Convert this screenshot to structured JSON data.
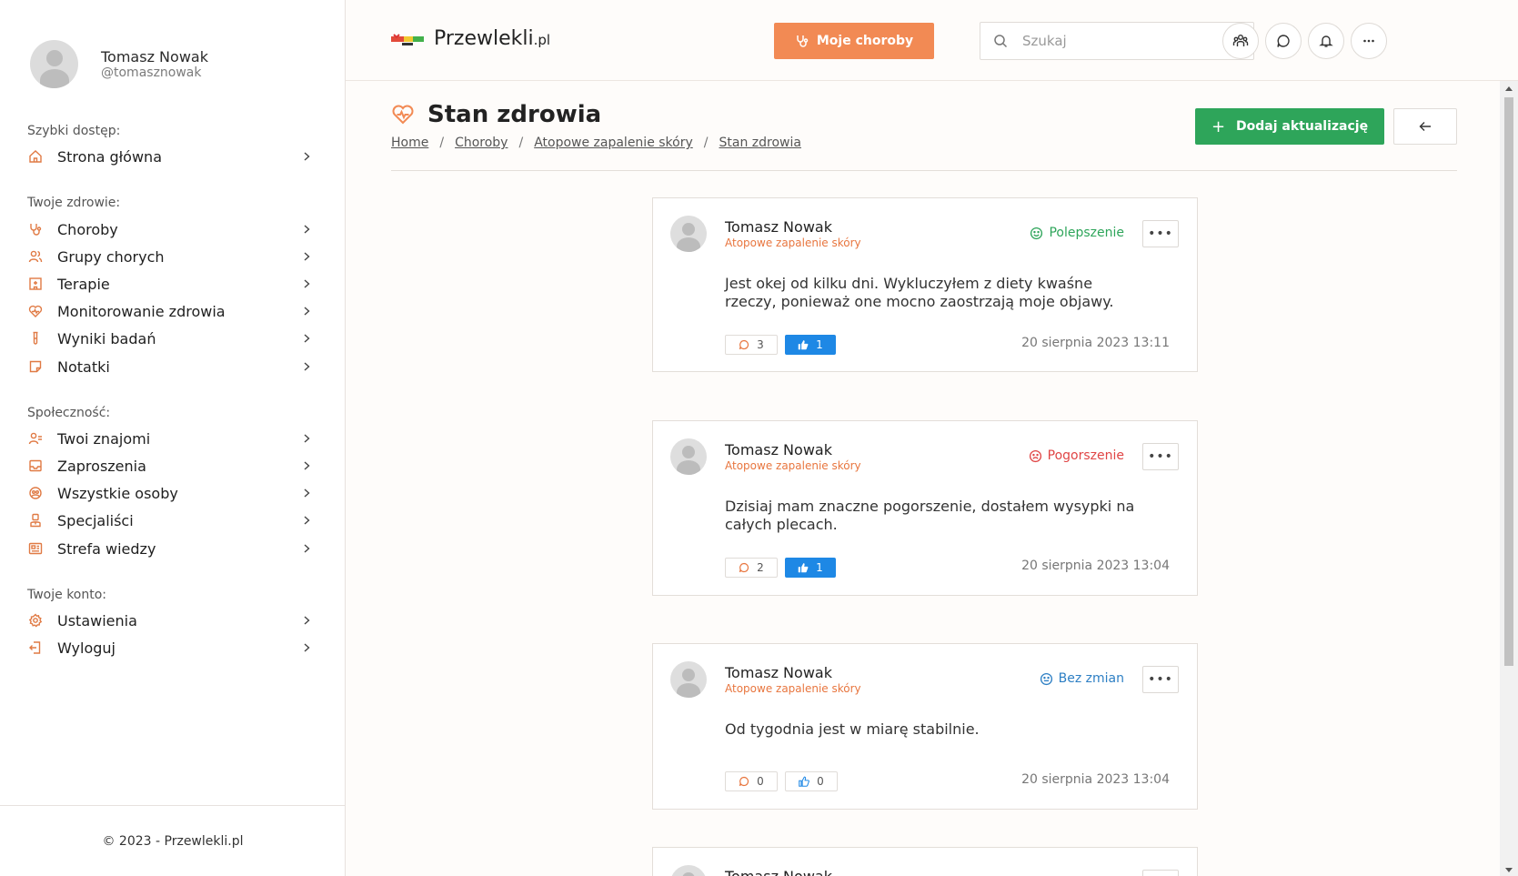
{
  "sidebar": {
    "user": {
      "name": "Tomasz Nowak",
      "handle": "@tomasznowak"
    },
    "sections": [
      {
        "title": "Szybki dostęp:",
        "items": [
          {
            "label": "Strona główna",
            "icon": "home-icon"
          }
        ]
      },
      {
        "title": "Twoje zdrowie:",
        "items": [
          {
            "label": "Choroby",
            "icon": "stethoscope-icon"
          },
          {
            "label": "Grupy chorych",
            "icon": "users-icon"
          },
          {
            "label": "Terapie",
            "icon": "hospital-icon"
          },
          {
            "label": "Monitorowanie zdrowia",
            "icon": "heart-pulse-icon"
          },
          {
            "label": "Wyniki badań",
            "icon": "test-tube-icon"
          },
          {
            "label": "Notatki",
            "icon": "note-icon"
          }
        ]
      },
      {
        "title": "Społeczność:",
        "items": [
          {
            "label": "Twoi znajomi",
            "icon": "user-check-icon"
          },
          {
            "label": "Zaproszenia",
            "icon": "inbox-icon"
          },
          {
            "label": "Wszystkie osoby",
            "icon": "globe-icon"
          },
          {
            "label": "Specjaliści",
            "icon": "doctor-icon"
          },
          {
            "label": "Strefa wiedzy",
            "icon": "newspaper-icon"
          }
        ]
      },
      {
        "title": "Twoje konto:",
        "items": [
          {
            "label": "Ustawienia",
            "icon": "gear-icon"
          },
          {
            "label": "Wyloguj",
            "icon": "logout-icon"
          }
        ]
      }
    ],
    "footer": "© 2023 - Przewlekli.pl"
  },
  "header": {
    "logo_text": "Przewlekli",
    "logo_suffix": ".pl",
    "my_diseases_label": "Moje choroby",
    "search_placeholder": "Szukaj"
  },
  "page": {
    "title": "Stan zdrowia",
    "breadcrumb": [
      "Home",
      "Choroby",
      "Atopowe zapalenie skóry",
      "Stan zdrowia"
    ],
    "add_update_label": "Dodaj aktualizację"
  },
  "posts": [
    {
      "author": "Tomasz Nowak",
      "disease": "Atopowe zapalenie skóry",
      "status": "Polepszenie",
      "status_type": "better",
      "text": "Jest okej od kilku dni. Wykluczyłem z diety kwaśne rzeczy, ponieważ one mocno zaostrzają moje objawy.",
      "comments": "3",
      "likes": "1",
      "liked": true,
      "date": "20 sierpnia 2023 13:11"
    },
    {
      "author": "Tomasz Nowak",
      "disease": "Atopowe zapalenie skóry",
      "status": "Pogorszenie",
      "status_type": "worse",
      "text": "Dzisiaj mam znaczne pogorszenie, dostałem wysypki na całych plecach.",
      "comments": "2",
      "likes": "1",
      "liked": true,
      "date": "20 sierpnia 2023 13:04"
    },
    {
      "author": "Tomasz Nowak",
      "disease": "Atopowe zapalenie skóry",
      "status": "Bez zmian",
      "status_type": "same",
      "text": "Od tygodnia jest w miarę stabilnie.",
      "comments": "0",
      "likes": "0",
      "liked": false,
      "date": "20 sierpnia 2023 13:04"
    },
    {
      "author": "Tomasz Nowak"
    }
  ],
  "colors": {
    "accent": "#f28a54",
    "green": "#2ea55a",
    "like_blue": "#1e88e5",
    "red": "#e04545",
    "blue": "#2d7fc4"
  }
}
